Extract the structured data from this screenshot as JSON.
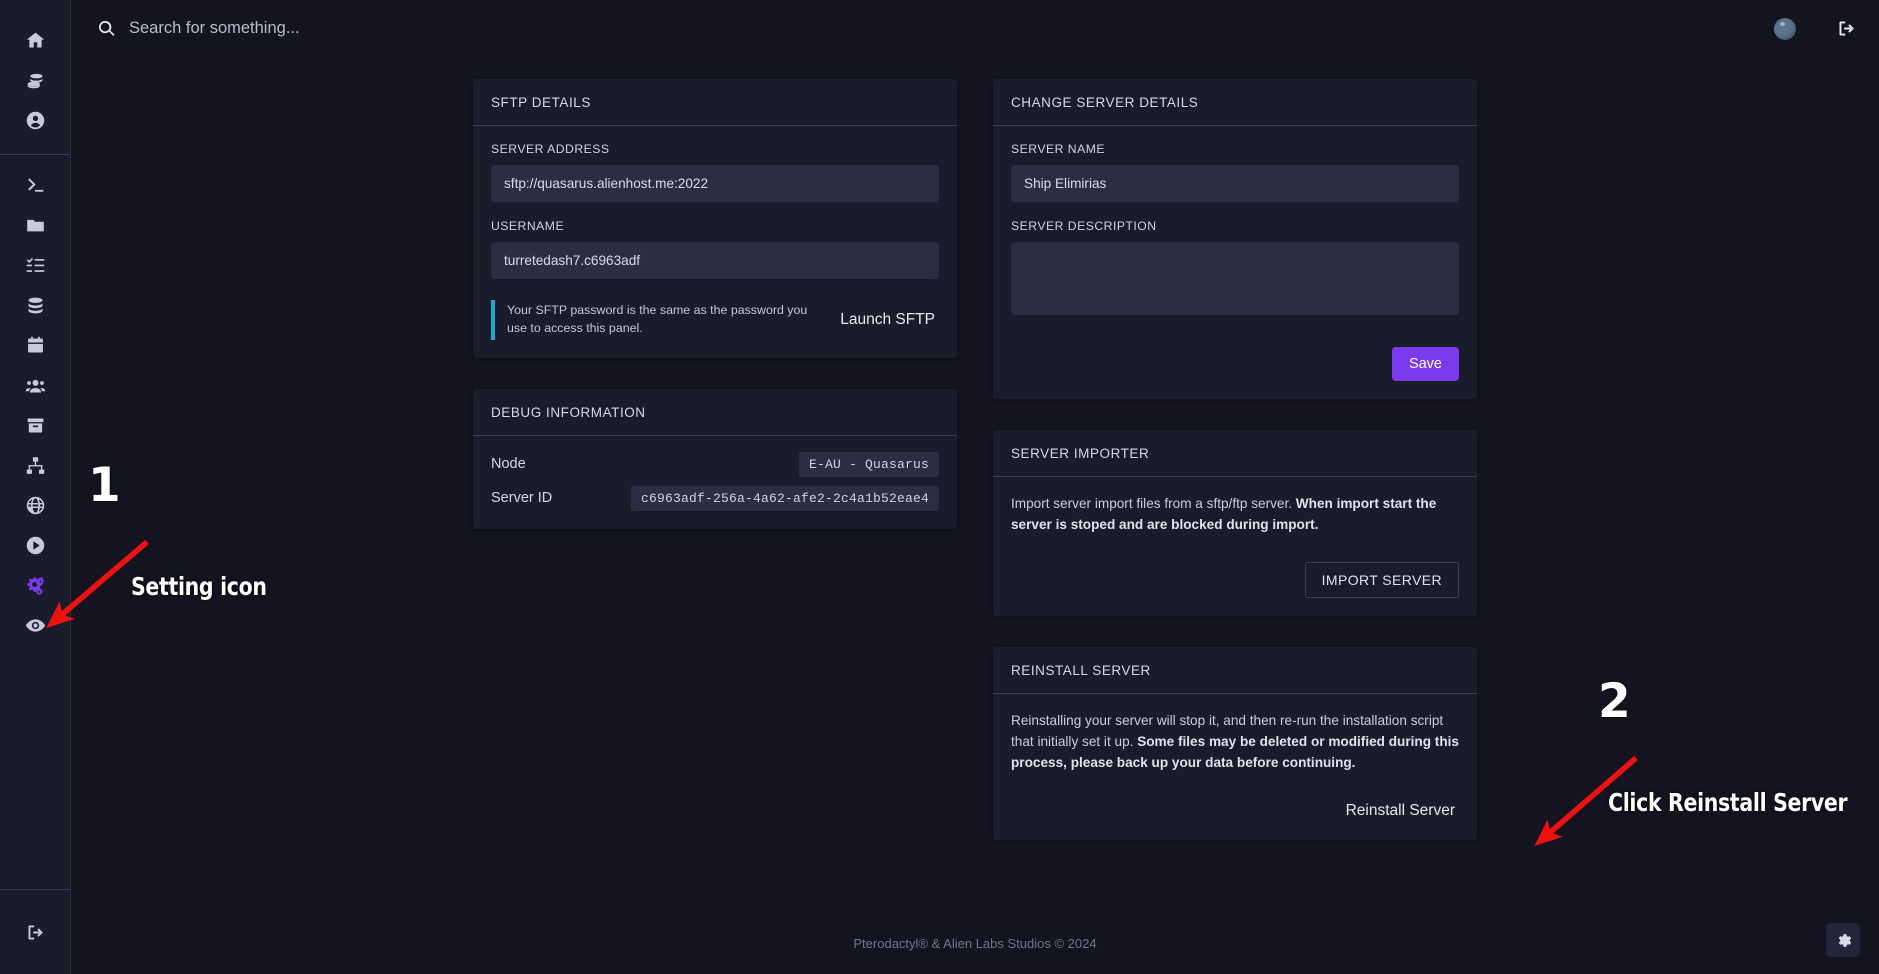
{
  "search": {
    "placeholder": "Search for something...",
    "value": "",
    "icon": "search-icon"
  },
  "sidebar": {
    "top_items": [
      {
        "icon": "home-icon",
        "name": "home"
      },
      {
        "icon": "database-stack-icon",
        "name": "servers"
      },
      {
        "icon": "user-circle-icon",
        "name": "account"
      }
    ],
    "server_items": [
      {
        "icon": "terminal-icon",
        "name": "console"
      },
      {
        "icon": "folder-icon",
        "name": "files"
      },
      {
        "icon": "list-check-icon",
        "name": "schedules"
      },
      {
        "icon": "database-icon",
        "name": "databases"
      },
      {
        "icon": "calendar-icon",
        "name": "backups"
      },
      {
        "icon": "users-icon",
        "name": "users"
      },
      {
        "icon": "archive-box-icon",
        "name": "archive"
      },
      {
        "icon": "network-icon",
        "name": "network"
      },
      {
        "icon": "globe-icon",
        "name": "domains"
      },
      {
        "icon": "play-circle-icon",
        "name": "startup"
      },
      {
        "icon": "gears-icon",
        "name": "settings",
        "active": true
      },
      {
        "icon": "eye-icon",
        "name": "activity"
      }
    ],
    "bottom_item": {
      "icon": "logout-icon",
      "name": "logout"
    }
  },
  "topbar": {
    "avatar": "user-avatar",
    "logout_icon": "logout-icon"
  },
  "sftp_details": {
    "title": "SFTP Details",
    "server_address_label": "Server Address",
    "server_address_value": "sftp://quasarus.alienhost.me:2022",
    "username_label": "Username",
    "username_value": "turretedash7.c6963adf",
    "notice": "Your SFTP password is the same as the password you use to access this panel.",
    "notice_accent": "#1aaecd",
    "launch_label": "Launch SFTP"
  },
  "debug_information": {
    "title": "Debug Information",
    "rows": [
      {
        "key": "Node",
        "value": "E-AU - Quasarus"
      },
      {
        "key": "Server ID",
        "value": "c6963adf-256a-4a62-afe2-2c4a1b52eae4"
      }
    ]
  },
  "change_server_details": {
    "title": "Change Server Details",
    "server_name_label": "Server Name",
    "server_name_value": "Ship Elimirias",
    "server_description_label": "Server Description",
    "server_description_value": "",
    "save_label": "Save",
    "save_color": "#7c3aed"
  },
  "server_importer": {
    "title": "Server Importer",
    "body_normal": "Import server import files from a sftp/ftp server. ",
    "body_bold": "When import start the server is stoped and are blocked during import.",
    "button_label": "IMPORT SERVER"
  },
  "reinstall_server": {
    "title": "Reinstall Server",
    "body_normal": "Reinstalling your server will stop it, and then re-run the installation script that initially set it up. ",
    "body_bold": "Some files may be deleted or modified during this process, please back up your data before continuing.",
    "button_label": "Reinstall Server"
  },
  "footer": {
    "text": "Pterodactyl® & Alien Labs Studios © 2024"
  },
  "fab": {
    "icon": "gear-icon"
  },
  "annotations": {
    "arrow_color": "#ee1111",
    "items": [
      {
        "number": "1",
        "label": "Setting icon"
      },
      {
        "number": "2",
        "label": "Click Reinstall Server"
      }
    ]
  }
}
